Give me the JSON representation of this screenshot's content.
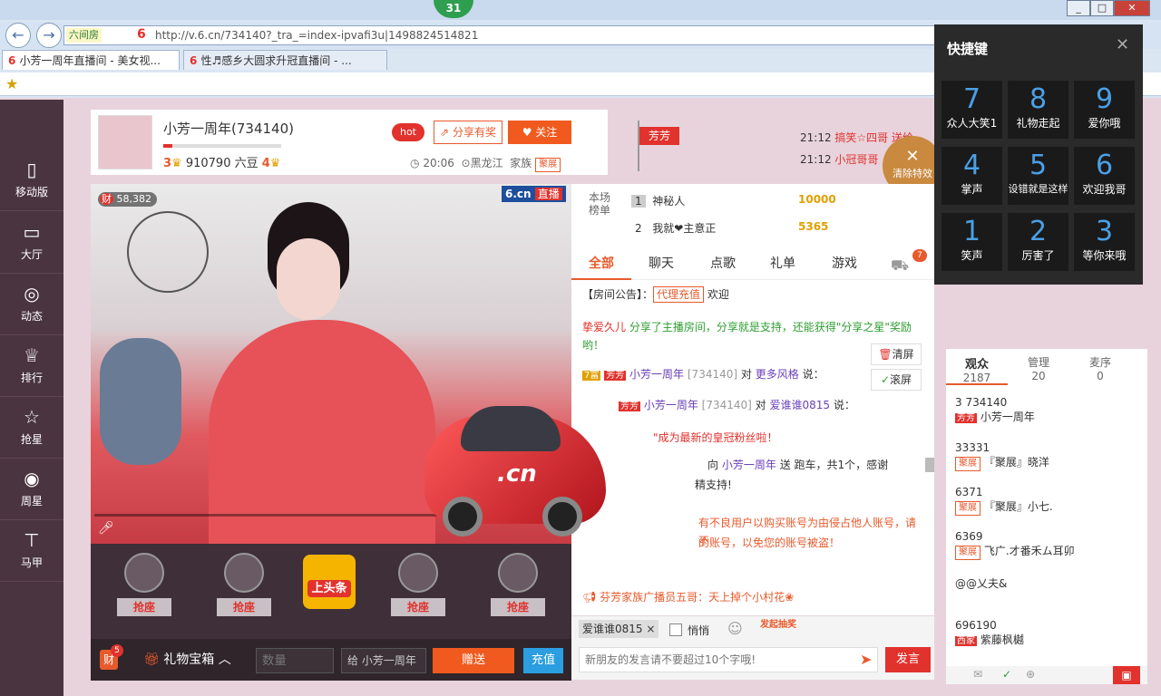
{
  "browser": {
    "badge": "31",
    "back": "←",
    "forward": "→",
    "room_tag": "六间房",
    "url": "http://v.6.cn/734140?_tra_=index-ipvafi3u|1498824514821",
    "tabs": [
      "小芳一周年直播间 - 美女视...",
      "性♬感乡大圆求升冠直播间 - ..."
    ],
    "tab_close": "×"
  },
  "leftnav": [
    {
      "icon": "▯",
      "label": "移动版"
    },
    {
      "icon": "▭",
      "label": "大厅"
    },
    {
      "icon": "◎",
      "label": "动态"
    },
    {
      "icon": "♕",
      "label": "排行"
    },
    {
      "icon": "☆",
      "label": "抢星"
    },
    {
      "icon": "◉",
      "label": "周星"
    },
    {
      "icon": "⊤",
      "label": "马甲"
    }
  ],
  "room": {
    "name": "小芳一周年(734140)",
    "level": "3",
    "beans": "910790 六豆",
    "rich_level": "4",
    "hot": "hot",
    "share": "分享有奖",
    "follow": "关注",
    "time": "20:06",
    "location": "黑龙江",
    "family": "家族",
    "family_tag": "聚展",
    "flag": "芳芳"
  },
  "ticker": [
    {
      "time": "21:12",
      "text": "搞笑☆四哥 送给"
    },
    {
      "time": "21:12",
      "text": "小冠哥哥"
    }
  ],
  "clear_effects": "清除特效",
  "video": {
    "viewers": "58,382",
    "logo": "6.cn",
    "live": "直播",
    "rich_badge": "财"
  },
  "seats": [
    "抢座",
    "抢座",
    "上头条",
    "抢座",
    "抢座"
  ],
  "giftbar": {
    "badge": "财",
    "badge_count": "5",
    "gift_box": "礼物宝箱",
    "qty_placeholder": "数量",
    "to": "给",
    "recipient": "小芳一周年",
    "send": "赠送",
    "recharge": "充值"
  },
  "rank": {
    "label": "本场榜单",
    "rows": [
      {
        "pos": "1",
        "name": "神秘人",
        "amount": "10000"
      },
      {
        "pos": "2",
        "name": "我就❤主意正",
        "amount": "5365"
      }
    ]
  },
  "chat_tabs": [
    "全部",
    "聊天",
    "点歌",
    "礼单",
    "游戏"
  ],
  "car_badge": "7",
  "chat": {
    "notice_label": "【房间公告】：",
    "notice_tag": "代理充值",
    "notice_text": "欢迎",
    "share_msg_user": "挚爱久儿",
    "share_msg": "分享了主播房间，分享就是支持，还能获得\"分享之星\"奖励哟！",
    "clear": "清屏",
    "scroll": "滚屏",
    "msg1_tag1": "7富",
    "msg1_tag2": "芳芳",
    "msg1_user": "小芳一周年",
    "msg1_id": "[734140]",
    "msg1_to": "对",
    "msg1_target": "更多风格",
    "msg1_say": "说：",
    "msg2_tag": "芳芳",
    "msg2_user": "小芳一周年",
    "msg2_id": "[734140]",
    "msg2_to": "对",
    "msg2_target": "爱谁谁0815",
    "msg2_say": "说：",
    "msg3": "\"成为最新的皇冠粉丝啦！",
    "msg4_pre": "向",
    "msg4_user": "小芳一周年",
    "msg4_send": "送",
    "msg4_gift": "跑车，共1个，感谢",
    "msg4_tail": "精支持!",
    "warn": "有不良用户以购买账号为由侵占他人账号，请不",
    "warn2": "的账号，以免您的账号被盗！",
    "broadcast": "芬芳家族广播员五哥：天上掉个小村花❀"
  },
  "input": {
    "target": "爱谁谁0815",
    "private": "悄悄",
    "lottery": "发起抽奖",
    "placeholder": "新朋友的发言请不要超过10个字哦!",
    "send": "发言"
  },
  "audience": {
    "tabs": [
      {
        "label": "观众",
        "count": "2187"
      },
      {
        "label": "管理",
        "count": "20"
      },
      {
        "label": "麦序",
        "count": "0"
      }
    ],
    "list": [
      {
        "top": "3 734140",
        "tag": "芳芳",
        "name": "小芳一周年"
      },
      {
        "top": "33331",
        "tag": "聚展",
        "name": "『聚展』晓洋"
      },
      {
        "top": "6371",
        "tag": "聚展",
        "name": "『聚展』小七."
      },
      {
        "top": "6369",
        "tag": "聚展",
        "name": "飞广.才番禾ム耳卯"
      },
      {
        "top": "",
        "tag": "",
        "name": "@@乂夫&"
      },
      {
        "top": "696190",
        "tag": "西家",
        "name": "紫藤枫樾"
      }
    ]
  },
  "shortcut": {
    "title": "快捷键",
    "items": [
      {
        "n": "7",
        "t": "众人大笑1"
      },
      {
        "n": "8",
        "t": "礼物走起"
      },
      {
        "n": "9",
        "t": "爱你哦"
      },
      {
        "n": "4",
        "t": "掌声"
      },
      {
        "n": "5",
        "t": "设错就是这样"
      },
      {
        "n": "6",
        "t": "欢迎我哥"
      },
      {
        "n": "1",
        "t": "笑声"
      },
      {
        "n": "2",
        "t": "厉害了"
      },
      {
        "n": "3",
        "t": "等你来哦"
      }
    ]
  },
  "colors": {
    "accent": "#f05a1e",
    "red": "#e1322d",
    "blue": "#2a7fd4"
  }
}
